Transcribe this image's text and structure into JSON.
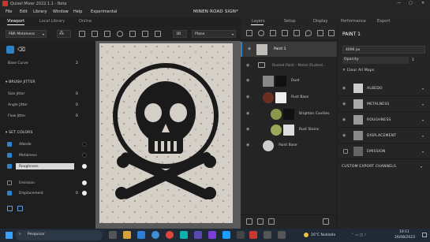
{
  "app": {
    "title": "Quixel Mixer 2022.1.1 - Beta",
    "center_title": "MINEN ROAD SIGN*",
    "window_controls": [
      "—",
      "▢",
      "✕"
    ]
  },
  "menu": [
    "File",
    "Edit",
    "Library",
    "Window",
    "Help",
    "Experimental"
  ],
  "left_tabs": [
    "Viewport",
    "Local Library",
    "Online"
  ],
  "right_tabs": [
    "Layers",
    "Setup",
    "Display",
    "Performance",
    "Export"
  ],
  "toolbar": {
    "preset": "PBR Metalness",
    "view_mode": "3D",
    "shape": "Plane"
  },
  "brush": {
    "base_curve_label": "Base Curve",
    "base_curve_value": "2",
    "jitter_header": "BRUSH JITTER",
    "jitter": [
      {
        "label": "Size Jitter",
        "value": "0"
      },
      {
        "label": "Angle Jitter",
        "value": "0"
      },
      {
        "label": "Flow Jitter",
        "value": "0"
      }
    ],
    "colors_header": "SET COLORS",
    "channels": [
      {
        "label": "Albedo",
        "checked": true,
        "color": "#111111"
      },
      {
        "label": "Metalness",
        "checked": true,
        "color": "#111111"
      },
      {
        "label": "Roughness",
        "checked": true,
        "color": "#eeeeee"
      },
      {
        "label": "Emission",
        "checked": false,
        "color": "#eeeeee"
      },
      {
        "label": "Displacement",
        "checked": true,
        "value": "0",
        "color": "#eeeeee"
      }
    ]
  },
  "layers": [
    {
      "name": "Paint 1",
      "selected": true
    },
    {
      "name": "Rusted Paint - Metal (Rusted...",
      "folder": true
    },
    {
      "name": "Dust"
    },
    {
      "name": "Rust Base"
    },
    {
      "name": "Brighten Cavities"
    },
    {
      "name": "Rust Stains"
    },
    {
      "name": "Paint Base"
    }
  ],
  "props": {
    "title": "PAINT 1",
    "resolution": "4096 px",
    "opacity_label": "Opacity",
    "opacity_value": "1",
    "clear_all": "Clear All Maps",
    "maps": [
      {
        "label": "ALBEDO",
        "enabled": true
      },
      {
        "label": "METALNESS",
        "enabled": true
      },
      {
        "label": "ROUGHNESS",
        "enabled": true
      },
      {
        "label": "DISPLACEMENT",
        "enabled": true
      },
      {
        "label": "EMISSION",
        "enabled": false
      }
    ],
    "custom_export": "CUSTOM EXPORT CHANNELS"
  },
  "taskbar": {
    "search": "Pesquisar",
    "weather": "16°C  Nublado",
    "time": "10:11",
    "date": "26/08/2023"
  },
  "colors": {
    "accent": "#2d82c9",
    "brand": "#c8382f"
  }
}
